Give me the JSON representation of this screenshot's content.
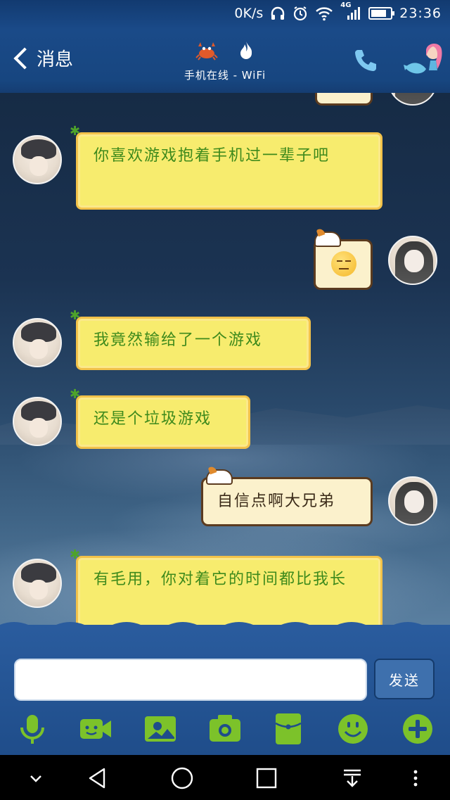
{
  "status_bar": {
    "network_speed": "0K/s",
    "network_type": "4G",
    "time": "23:36",
    "battery_level": 0.8
  },
  "header": {
    "back_label": "消息",
    "subtitle": "手机在线 - WiFi"
  },
  "messages": [
    {
      "side": "left",
      "text": "你喜欢游戏抱着手机过一辈子吧"
    },
    {
      "side": "right",
      "emoji": "unamused-face-emoji"
    },
    {
      "side": "left",
      "text": "我竟然输给了一个游戏"
    },
    {
      "side": "left",
      "text": "还是个垃圾游戏"
    },
    {
      "side": "right",
      "text": "自信点啊大兄弟"
    },
    {
      "side": "left",
      "text": "有毛用，你对着它的时间都比我长"
    }
  ],
  "input": {
    "value": "",
    "send_label": "发送"
  },
  "toolbar": [
    "microphone-icon",
    "video-call-icon",
    "image-icon",
    "camera-icon",
    "red-packet-icon",
    "emoji-icon",
    "plus-icon"
  ],
  "colors": {
    "header_blue": "#1a4a88",
    "bubble_yellow": "#f7ec6e",
    "bubble_text_green": "#3e8a1c",
    "toolbar_green": "#7cc22a"
  }
}
